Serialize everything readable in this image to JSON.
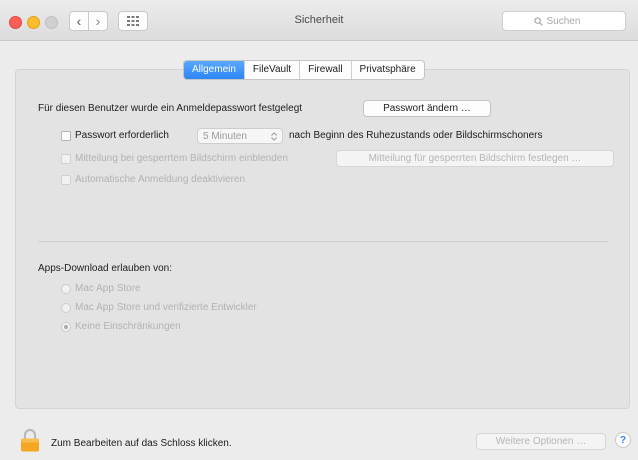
{
  "window": {
    "title": "Sicherheit",
    "search_placeholder": "Suchen",
    "back_glyph": "‹",
    "forward_glyph": "›"
  },
  "tabs": [
    {
      "label": "Allgemein",
      "active": true
    },
    {
      "label": "FileVault",
      "active": false
    },
    {
      "label": "Firewall",
      "active": false
    },
    {
      "label": "Privatsphäre",
      "active": false
    }
  ],
  "general": {
    "password_set_text": "Für diesen Benutzer wurde ein Anmeldepasswort festgelegt",
    "change_password_button": "Passwort ändern …",
    "require_password_label": "Passwort erforderlich",
    "require_password_delay": "5 Minuten",
    "require_password_suffix": "nach Beginn des Ruhezustands oder Bildschirmschoners",
    "show_message_label": "Mitteilung bei gesperrtem Bildschirm einblenden",
    "set_message_button": "Mitteilung für gesperrten Bildschirm festlegen …",
    "disable_autologin_label": "Automatische Anmeldung deaktivieren"
  },
  "apps_download": {
    "heading": "Apps-Download erlauben von:",
    "options": [
      {
        "label": "Mac App Store",
        "selected": false
      },
      {
        "label": "Mac App Store und verifizierte Entwickler",
        "selected": false
      },
      {
        "label": "Keine Einschränkungen",
        "selected": true
      }
    ]
  },
  "footer": {
    "lock_text": "Zum Bearbeiten auf das Schloss klicken.",
    "advanced_button": "Weitere Optionen …",
    "help_glyph": "?"
  },
  "colors": {
    "accent": "#2c86f5",
    "close": "#fc5f57",
    "minimize": "#fdbc2e",
    "lock": "#f5a623"
  }
}
